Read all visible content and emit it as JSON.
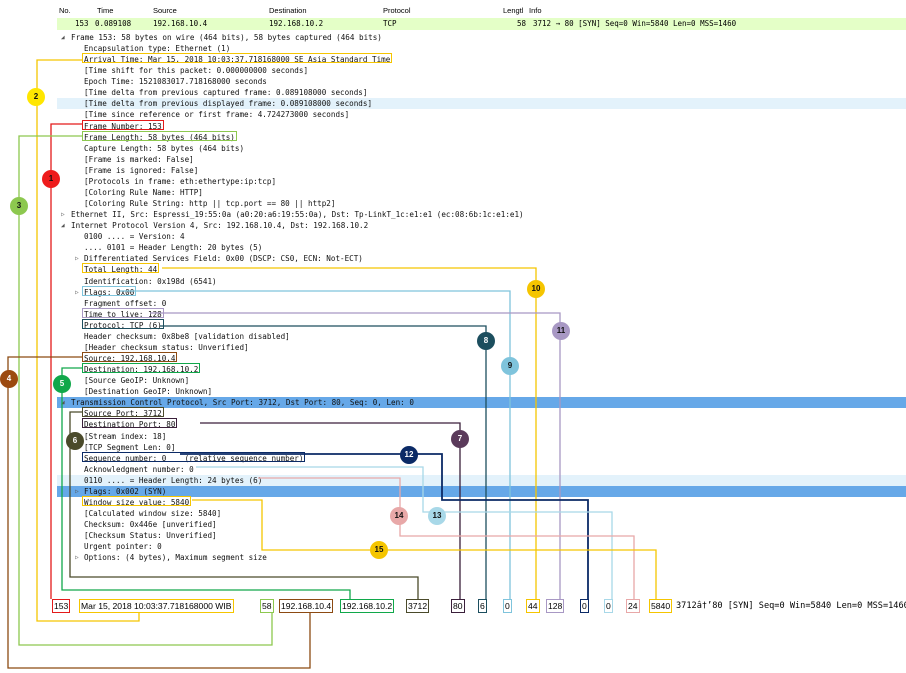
{
  "packet_list": {
    "headers": [
      "No.",
      "Time",
      "Source",
      "Destination",
      "Protocol",
      "Lengtl",
      "Info"
    ],
    "row": {
      "no": "153",
      "time": "0.089108",
      "source": "192.168.10.4",
      "destination": "192.168.10.2",
      "protocol": "TCP",
      "length": "58",
      "info": "3712 → 80 [SYN] Seq=0 Win=5840 Len=0 MSS=1460"
    }
  },
  "detail_lines": [
    {
      "text": "Frame 153: 58 bytes on wire (464 bits), 58 bytes captured (464 bits)",
      "indent": 0,
      "arrow": "◢"
    },
    {
      "text": "Encapsulation type: Ethernet (1)",
      "indent": 1
    },
    {
      "text": "Arrival Time: Mar 15, 2018 10:03:37.718168000 SE Asia Standard Time",
      "indent": 1,
      "box": "#f5c500"
    },
    {
      "text": "[Time shift for this packet: 0.000000000 seconds]",
      "indent": 1
    },
    {
      "text": "Epoch Time: 1521083017.718168000 seconds",
      "indent": 1
    },
    {
      "text": "[Time delta from previous captured frame: 0.089108000 seconds]",
      "indent": 1
    },
    {
      "text": "[Time delta from previous displayed frame: 0.089108000 seconds]",
      "indent": 1,
      "bg": "light"
    },
    {
      "text": "[Time since reference or first frame: 4.724273000 seconds]",
      "indent": 1
    },
    {
      "text": "Frame Number: 153",
      "indent": 1,
      "box": "#e31a1a"
    },
    {
      "text": "Frame Length: 58 bytes (464 bits)",
      "indent": 1,
      "box": "#8dc84f"
    },
    {
      "text": "Capture Length: 58 bytes (464 bits)",
      "indent": 1
    },
    {
      "text": "[Frame is marked: False]",
      "indent": 1
    },
    {
      "text": "[Frame is ignored: False]",
      "indent": 1
    },
    {
      "text": "[Protocols in frame: eth:ethertype:ip:tcp]",
      "indent": 1
    },
    {
      "text": "[Coloring Rule Name: HTTP]",
      "indent": 1
    },
    {
      "text": "[Coloring Rule String: http || tcp.port == 80 || http2]",
      "indent": 1
    },
    {
      "text": "Ethernet II, Src: Espressi_19:55:0a (a0:20:a6:19:55:0a), Dst: Tp-LinkT_1c:e1:e1 (ec:08:6b:1c:e1:e1)",
      "indent": 0,
      "arrow": "▷"
    },
    {
      "text": "Internet Protocol Version 4, Src: 192.168.10.4, Dst: 192.168.10.2",
      "indent": 0,
      "arrow": "◢"
    },
    {
      "text": "0100 .... = Version: 4",
      "indent": 1
    },
    {
      "text": ".... 0101 = Header Length: 20 bytes (5)",
      "indent": 1
    },
    {
      "text": "Differentiated Services Field: 0x00 (DSCP: CS0, ECN: Not-ECT)",
      "indent": 1,
      "arrow": "▷"
    },
    {
      "text": "Total Length: 44",
      "indent": 1,
      "box": "#f5c500"
    },
    {
      "text": "Identification: 0x198d (6541)",
      "indent": 1
    },
    {
      "text": "Flags: 0x00",
      "indent": 1,
      "arrow": "▷",
      "box": "#7fc4dc"
    },
    {
      "text": "Fragment offset: 0",
      "indent": 1
    },
    {
      "text": "Time to live: 128",
      "indent": 1,
      "box": "#a898c4"
    },
    {
      "text": "Protocol: TCP (6)",
      "indent": 1,
      "box": "#1c4e5e"
    },
    {
      "text": "Header checksum: 0x8be8 [validation disabled]",
      "indent": 1
    },
    {
      "text": "[Header checksum status: Unverified]",
      "indent": 1
    },
    {
      "text": "Source: 192.168.10.4",
      "indent": 1,
      "box": "#8c4a12"
    },
    {
      "text": "Destination: 192.168.10.2",
      "indent": 1,
      "box": "#10a84a"
    },
    {
      "text": "[Source GeoIP: Unknown]",
      "indent": 1
    },
    {
      "text": "[Destination GeoIP: Unknown]",
      "indent": 1
    },
    {
      "text": "Transmission Control Protocol, Src Port: 3712, Dst Port: 80, Seq: 0, Len: 0",
      "indent": 0,
      "arrow": "◢",
      "bg": "blue"
    },
    {
      "text": "Source Port: 3712",
      "indent": 1,
      "box": "#4a4a2a"
    },
    {
      "text": "Destination Port: 80",
      "indent": 1,
      "box": "#3a1f3a"
    },
    {
      "text": "[Stream index: 18]",
      "indent": 1
    },
    {
      "text": "[TCP Segment Len: 0]",
      "indent": 1
    },
    {
      "text": "Sequence number: 0    (relative sequence number)",
      "indent": 1,
      "box": "#0b2a66"
    },
    {
      "text": "Acknowledgment number: 0",
      "indent": 1
    },
    {
      "text": "0110 .... = Header Length: 24 bytes (6)",
      "indent": 1,
      "bg": "light"
    },
    {
      "text": "Flags: 0x002 (SYN)",
      "indent": 1,
      "arrow": "▷",
      "bg": "blue"
    },
    {
      "text": "Window size value: 5840",
      "indent": 1,
      "box": "#f5c500"
    },
    {
      "text": "[Calculated window size: 5840]",
      "indent": 1
    },
    {
      "text": "Checksum: 0x446e [unverified]",
      "indent": 1
    },
    {
      "text": "[Checksum Status: Unverified]",
      "indent": 1
    },
    {
      "text": "Urgent pointer: 0",
      "indent": 1
    },
    {
      "text": "Options: (4 bytes), Maximum segment size",
      "indent": 1,
      "arrow": "▷"
    }
  ],
  "summary": {
    "cells": [
      {
        "text": "153",
        "color": "#e31a1a"
      },
      {
        "text": "Mar 15, 2018 10:03:37.718168000 WIB",
        "color": "#f5c500"
      },
      {
        "text": "58",
        "color": "#8dc84f"
      },
      {
        "text": "192.168.10.4",
        "color": "#8c4a12"
      },
      {
        "text": "192.168.10.2",
        "color": "#10a84a"
      },
      {
        "text": "3712",
        "color": "#4a4a2a"
      },
      {
        "text": "80",
        "color": "#3a1f3a"
      },
      {
        "text": "6",
        "color": "#1c4e5e"
      },
      {
        "text": "0",
        "color": "#7fc4dc"
      },
      {
        "text": "44",
        "color": "#f5c500"
      },
      {
        "text": "128",
        "color": "#a898c4"
      },
      {
        "text": "0",
        "color": "#0b2a66"
      },
      {
        "text": "0",
        "color": "#a8d8e8"
      },
      {
        "text": "24",
        "color": "#e8a8a8"
      },
      {
        "text": "5840",
        "color": "#f5c500"
      }
    ],
    "info": "3712â†’80 [SYN] Seq=0 Win=5840 Len=0 MSS=1460"
  },
  "badges": [
    {
      "label": "1",
      "color": "#ee1c1c"
    },
    {
      "label": "2",
      "color": "#ffe600"
    },
    {
      "label": "3",
      "color": "#8dc84f"
    },
    {
      "label": "4",
      "color": "#9c4a10"
    },
    {
      "label": "5",
      "color": "#10a84a"
    },
    {
      "label": "6",
      "color": "#4a4a2a"
    },
    {
      "label": "7",
      "color": "#5a3a5a"
    },
    {
      "label": "8",
      "color": "#1c4e5e"
    },
    {
      "label": "9",
      "color": "#7fc4dc"
    },
    {
      "label": "10",
      "color": "#f5c500"
    },
    {
      "label": "11",
      "color": "#a898c4"
    },
    {
      "label": "12",
      "color": "#0b2a66"
    },
    {
      "label": "13",
      "color": "#a8d8e8"
    },
    {
      "label": "14",
      "color": "#e8a8a8"
    },
    {
      "label": "15",
      "color": "#f5c500"
    }
  ]
}
